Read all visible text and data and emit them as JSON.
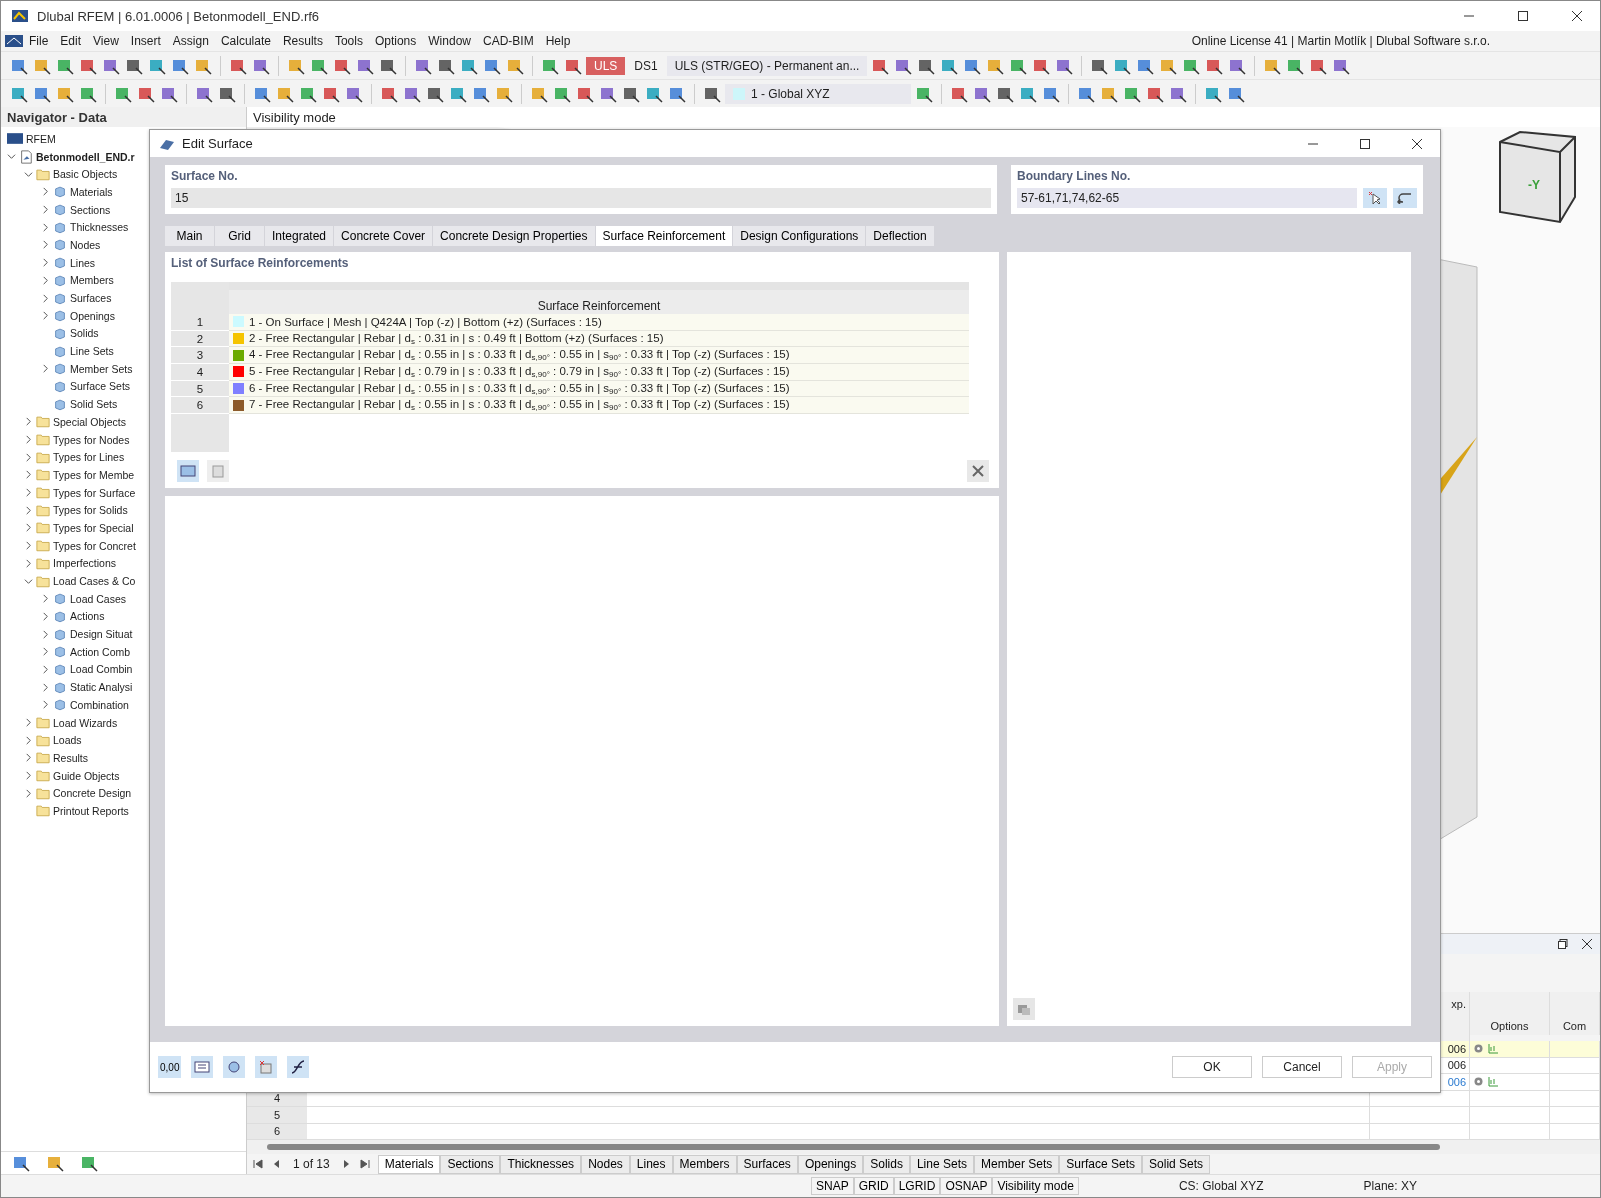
{
  "window": {
    "title": "Dlubal RFEM | 6.01.0006 | Betonmodell_END.rf6"
  },
  "menu": [
    "File",
    "Edit",
    "View",
    "Insert",
    "Assign",
    "Calculate",
    "Results",
    "Tools",
    "Options",
    "Window",
    "CAD-BIM",
    "Help"
  ],
  "license": "Online License 41 | Martin Motlík | Dlubal Software s.r.o.",
  "toolbar": {
    "load_type": "ULS",
    "design_situation": "DS1",
    "combo": "ULS (STR/GEO) - Permanent an...",
    "coordinate_system": "1 - Global XYZ"
  },
  "navigator": {
    "title": "Navigator - Data",
    "root": "RFEM",
    "tree": [
      {
        "label": "Betonmodell_END.r",
        "kind": "model",
        "expanded": true,
        "children": [
          {
            "label": "Basic Objects",
            "kind": "folder",
            "expanded": true,
            "children": [
              {
                "label": "Materials",
                "kind": "object",
                "expanded": false
              },
              {
                "label": "Sections",
                "kind": "object",
                "expanded": false
              },
              {
                "label": "Thicknesses",
                "kind": "object",
                "expanded": false
              },
              {
                "label": "Nodes",
                "kind": "object",
                "expanded": false
              },
              {
                "label": "Lines",
                "kind": "object",
                "expanded": false
              },
              {
                "label": "Members",
                "kind": "object",
                "expanded": false
              },
              {
                "label": "Surfaces",
                "kind": "object",
                "expanded": false
              },
              {
                "label": "Openings",
                "kind": "object",
                "expanded": false
              },
              {
                "label": "Solids",
                "kind": "object"
              },
              {
                "label": "Line Sets",
                "kind": "object"
              },
              {
                "label": "Member Sets",
                "kind": "object",
                "expanded": false
              },
              {
                "label": "Surface Sets",
                "kind": "object"
              },
              {
                "label": "Solid Sets",
                "kind": "object"
              }
            ]
          },
          {
            "label": "Special Objects",
            "kind": "folder",
            "expanded": false
          },
          {
            "label": "Types for Nodes",
            "kind": "folder",
            "expanded": false
          },
          {
            "label": "Types for Lines",
            "kind": "folder",
            "expanded": false
          },
          {
            "label": "Types for Membe",
            "kind": "folder",
            "expanded": false
          },
          {
            "label": "Types for Surface",
            "kind": "folder",
            "expanded": false
          },
          {
            "label": "Types for Solids",
            "kind": "folder",
            "expanded": false
          },
          {
            "label": "Types for Special",
            "kind": "folder",
            "expanded": false
          },
          {
            "label": "Types for Concret",
            "kind": "folder",
            "expanded": false
          },
          {
            "label": "Imperfections",
            "kind": "folder",
            "expanded": false
          },
          {
            "label": "Load Cases & Co",
            "kind": "folder",
            "expanded": true,
            "children": [
              {
                "label": "Load Cases",
                "kind": "object",
                "expanded": false
              },
              {
                "label": "Actions",
                "kind": "object",
                "expanded": false
              },
              {
                "label": "Design Situat",
                "kind": "object",
                "expanded": false
              },
              {
                "label": "Action Comb",
                "kind": "object",
                "expanded": false
              },
              {
                "label": "Load Combin",
                "kind": "object",
                "expanded": false
              },
              {
                "label": "Static Analysi",
                "kind": "object",
                "expanded": false
              },
              {
                "label": "Combination",
                "kind": "object",
                "expanded": false
              }
            ]
          },
          {
            "label": "Load Wizards",
            "kind": "folder",
            "expanded": false
          },
          {
            "label": "Loads",
            "kind": "folder",
            "expanded": false
          },
          {
            "label": "Results",
            "kind": "folder",
            "expanded": false
          },
          {
            "label": "Guide Objects",
            "kind": "folder",
            "expanded": false
          },
          {
            "label": "Concrete Design",
            "kind": "folder",
            "expanded": false
          },
          {
            "label": "Printout Reports",
            "kind": "folder"
          }
        ]
      }
    ]
  },
  "view": {
    "mode_label": "Visibility mode",
    "view_cube_label": "-Y"
  },
  "dialog": {
    "title": "Edit Surface",
    "surface_no": {
      "label": "Surface No.",
      "value": "15"
    },
    "boundary_lines": {
      "label": "Boundary Lines No.",
      "value": "57-61,71,74,62-65"
    },
    "tabs": [
      {
        "label": "Main",
        "selected": false
      },
      {
        "label": "Grid",
        "selected": false
      },
      {
        "label": "Integrated",
        "selected": false
      },
      {
        "label": "Concrete Cover",
        "selected": false
      },
      {
        "label": "Concrete Design Properties",
        "selected": false
      },
      {
        "label": "Surface Reinforcement",
        "selected": true
      },
      {
        "label": "Design Configurations",
        "selected": false
      },
      {
        "label": "Deflection",
        "selected": false
      }
    ],
    "list_title": "List of Surface Reinforcements",
    "table_header": "Surface Reinforcement",
    "rows": [
      {
        "number": "1",
        "color": "#ccfaff",
        "text": "1 - On Surface | Mesh | Q424A | Top (-z) | Bottom (+z) (Surfaces : 15)"
      },
      {
        "number": "2",
        "color": "#f5c400",
        "text": "2 - Free Rectangular | Rebar | d$_{s}$ : 0.31 in | s : 0.49 ft | Bottom (+z) (Surfaces : 15)"
      },
      {
        "number": "3",
        "color": "#6aaa00",
        "text": "4 - Free Rectangular | Rebar | d$_{s}$ : 0.55 in | s : 0.33 ft | d$_{s,90°}$ : 0.55 in | s$_{90°}$ : 0.33 ft | Top (-z) (Surfaces : 15)"
      },
      {
        "number": "4",
        "color": "#ff0000",
        "text": "5 - Free Rectangular | Rebar | d$_{s}$ : 0.79 in | s : 0.33 ft | d$_{s,90°}$ : 0.79 in | s$_{90°}$ : 0.33 ft | Top (-z) (Surfaces : 15)"
      },
      {
        "number": "5",
        "color": "#8080ff",
        "text": "6 - Free Rectangular | Rebar | d$_{s}$ : 0.55 in | s : 0.33 ft | d$_{s,90°}$ : 0.55 in | s$_{90°}$ : 0.33 ft | Top (-z) (Surfaces : 15)"
      },
      {
        "number": "6",
        "color": "#8c5a2a",
        "text": "7 - Free Rectangular | Rebar | d$_{s}$ : 0.55 in | s : 0.33 ft | d$_{s,90°}$ : 0.55 in | s$_{90°}$ : 0.33 ft | Top (-z) (Surfaces : 15)"
      }
    ],
    "footer_tools": [
      "0,00"
    ],
    "buttons": [
      {
        "label": "OK",
        "disabled": false
      },
      {
        "label": "Cancel",
        "disabled": false
      },
      {
        "label": "Apply",
        "disabled": true
      }
    ]
  },
  "bottom_table": {
    "columns": [
      "xp.",
      "Options",
      "Com"
    ],
    "rows": [
      {
        "value": "006",
        "link": false,
        "options": true,
        "highlighted": true
      },
      {
        "value": "006",
        "link": false,
        "options": false,
        "highlighted": false
      },
      {
        "value": "006",
        "link": true,
        "options": true,
        "highlighted": false
      },
      {
        "number": "4",
        "options": false,
        "highlighted": false
      },
      {
        "number": "5",
        "options": false,
        "highlighted": false
      },
      {
        "number": "6",
        "options": false,
        "highlighted": false
      }
    ]
  },
  "sheet_tabs": {
    "page": "1 of 13",
    "tabs": [
      {
        "label": "Materials",
        "selected": true
      },
      {
        "label": "Sections",
        "selected": false
      },
      {
        "label": "Thicknesses",
        "selected": false
      },
      {
        "label": "Nodes",
        "selected": false
      },
      {
        "label": "Lines",
        "selected": false
      },
      {
        "label": "Members",
        "selected": false
      },
      {
        "label": "Surfaces",
        "selected": false
      },
      {
        "label": "Openings",
        "selected": false
      },
      {
        "label": "Solids",
        "selected": false
      },
      {
        "label": "Line Sets",
        "selected": false
      },
      {
        "label": "Member Sets",
        "selected": false
      },
      {
        "label": "Surface Sets",
        "selected": false
      },
      {
        "label": "Solid Sets",
        "selected": false
      }
    ]
  },
  "status_bar": {
    "toggles": [
      "SNAP",
      "GRID",
      "LGRID",
      "OSNAP",
      "Visibility mode"
    ],
    "cs": "CS: Global XYZ",
    "plane": "Plane: XY"
  }
}
